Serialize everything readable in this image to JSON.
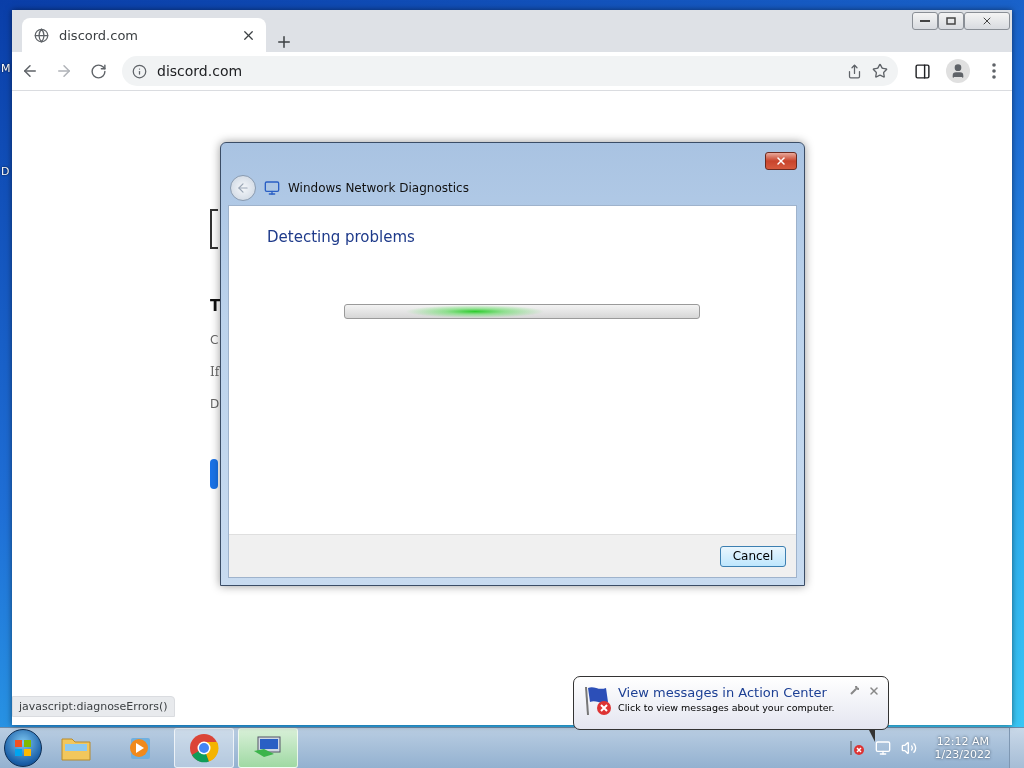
{
  "desktop": {
    "icon_labels": [
      "M",
      "D"
    ]
  },
  "browser": {
    "tabs": [
      {
        "title": "discord.com",
        "selected": true
      }
    ],
    "address": "discord.com",
    "status_link": "javascript:diagnoseErrors()",
    "page_fragments": [
      {
        "text": "T",
        "kind": "heading"
      },
      {
        "text": "C",
        "kind": "text"
      },
      {
        "text": "If",
        "kind": "serif"
      },
      {
        "text": "D",
        "kind": "text"
      }
    ]
  },
  "dialog": {
    "title": "Windows Network Diagnostics",
    "heading": "Detecting problems",
    "progress": {
      "indeterminate": true
    },
    "buttons": [
      "Cancel"
    ]
  },
  "notification": {
    "title": "View messages in Action Center",
    "message": "Click to view messages about your computer."
  },
  "taskbar": {
    "apps": [
      {
        "kind": "explorer",
        "running": false,
        "focused": false
      },
      {
        "kind": "media",
        "running": false,
        "focused": false
      },
      {
        "kind": "chrome",
        "running": true,
        "focused": false
      },
      {
        "kind": "network",
        "running": true,
        "focused": true
      }
    ],
    "clock": {
      "time": "12:12 AM",
      "date": "1/23/2022"
    }
  }
}
